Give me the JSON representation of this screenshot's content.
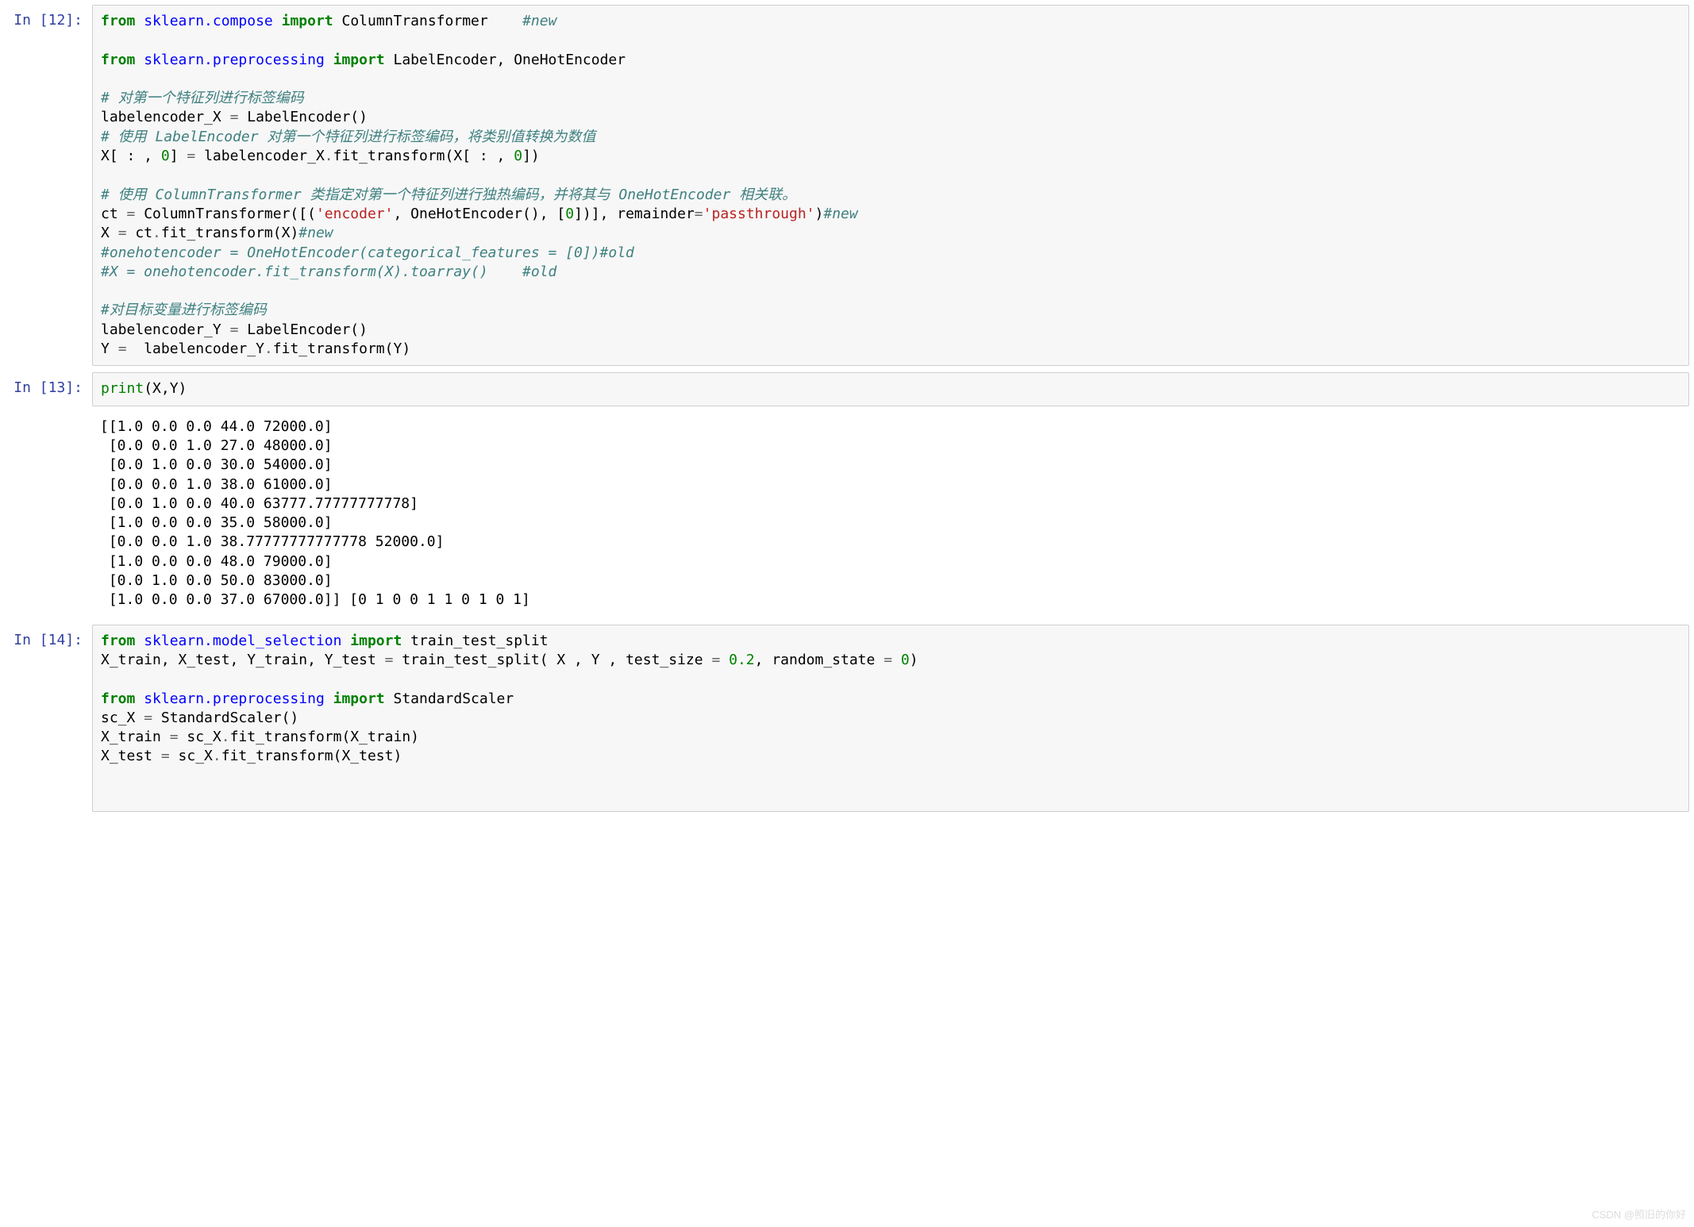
{
  "cells": [
    {
      "prompt": "In [12]:",
      "type": "code",
      "tokens": [
        {
          "t": "from",
          "c": "kn"
        },
        {
          "t": " "
        },
        {
          "t": "sklearn.compose",
          "c": "nn"
        },
        {
          "t": " "
        },
        {
          "t": "import",
          "c": "kn"
        },
        {
          "t": " ColumnTransformer    "
        },
        {
          "t": "#new",
          "c": "cm"
        },
        {
          "t": "\n"
        },
        {
          "t": "\n"
        },
        {
          "t": "from",
          "c": "kn"
        },
        {
          "t": " "
        },
        {
          "t": "sklearn.preprocessing",
          "c": "nn"
        },
        {
          "t": " "
        },
        {
          "t": "import",
          "c": "kn"
        },
        {
          "t": " LabelEncoder, OneHotEncoder"
        },
        {
          "t": "\n"
        },
        {
          "t": "\n"
        },
        {
          "t": "# 对第一个特征列进行标签编码",
          "c": "cm"
        },
        {
          "t": "\n"
        },
        {
          "t": "labelencoder_X "
        },
        {
          "t": "=",
          "c": "op"
        },
        {
          "t": " LabelEncoder()"
        },
        {
          "t": "\n"
        },
        {
          "t": "# 使用 LabelEncoder 对第一个特征列进行标签编码，将类别值转换为数值",
          "c": "cm"
        },
        {
          "t": "\n"
        },
        {
          "t": "X[ : , "
        },
        {
          "t": "0",
          "c": "num"
        },
        {
          "t": "] "
        },
        {
          "t": "=",
          "c": "op"
        },
        {
          "t": " labelencoder_X"
        },
        {
          "t": ".",
          "c": "op"
        },
        {
          "t": "fit_transform(X[ : , "
        },
        {
          "t": "0",
          "c": "num"
        },
        {
          "t": "])"
        },
        {
          "t": "\n"
        },
        {
          "t": "\n"
        },
        {
          "t": "# 使用 ColumnTransformer 类指定对第一个特征列进行独热编码，并将其与 OneHotEncoder 相关联。",
          "c": "cm"
        },
        {
          "t": "\n"
        },
        {
          "t": "ct "
        },
        {
          "t": "=",
          "c": "op"
        },
        {
          "t": " ColumnTransformer([("
        },
        {
          "t": "'encoder'",
          "c": "s"
        },
        {
          "t": ", OneHotEncoder(), ["
        },
        {
          "t": "0",
          "c": "num"
        },
        {
          "t": "])], remainder"
        },
        {
          "t": "=",
          "c": "op"
        },
        {
          "t": "'passthrough'",
          "c": "s"
        },
        {
          "t": ")"
        },
        {
          "t": "#new",
          "c": "cm"
        },
        {
          "t": "\n"
        },
        {
          "t": "X "
        },
        {
          "t": "=",
          "c": "op"
        },
        {
          "t": " ct"
        },
        {
          "t": ".",
          "c": "op"
        },
        {
          "t": "fit_transform(X)"
        },
        {
          "t": "#new",
          "c": "cm"
        },
        {
          "t": "\n"
        },
        {
          "t": "#onehotencoder = OneHotEncoder(categorical_features = [0])#old",
          "c": "cm"
        },
        {
          "t": "\n"
        },
        {
          "t": "#X = onehotencoder.fit_transform(X).toarray()    #old",
          "c": "cm"
        },
        {
          "t": "\n"
        },
        {
          "t": "\n"
        },
        {
          "t": "#对目标变量进行标签编码",
          "c": "cm"
        },
        {
          "t": "\n"
        },
        {
          "t": "labelencoder_Y "
        },
        {
          "t": "=",
          "c": "op"
        },
        {
          "t": " LabelEncoder()"
        },
        {
          "t": "\n"
        },
        {
          "t": "Y "
        },
        {
          "t": "=",
          "c": "op"
        },
        {
          "t": "  labelencoder_Y"
        },
        {
          "t": ".",
          "c": "op"
        },
        {
          "t": "fit_transform(Y)"
        }
      ]
    },
    {
      "prompt": "In [13]:",
      "type": "code",
      "tokens": [
        {
          "t": "print",
          "c": "bi"
        },
        {
          "t": "(X,Y)"
        }
      ]
    },
    {
      "prompt": "",
      "type": "output",
      "text": "[[1.0 0.0 0.0 44.0 72000.0]\n [0.0 0.0 1.0 27.0 48000.0]\n [0.0 1.0 0.0 30.0 54000.0]\n [0.0 0.0 1.0 38.0 61000.0]\n [0.0 1.0 0.0 40.0 63777.77777777778]\n [1.0 0.0 0.0 35.0 58000.0]\n [0.0 0.0 1.0 38.77777777777778 52000.0]\n [1.0 0.0 0.0 48.0 79000.0]\n [0.0 1.0 0.0 50.0 83000.0]\n [1.0 0.0 0.0 37.0 67000.0]] [0 1 0 0 1 1 0 1 0 1]"
    },
    {
      "prompt": "In [14]:",
      "type": "code",
      "tokens": [
        {
          "t": "from",
          "c": "kn"
        },
        {
          "t": " "
        },
        {
          "t": "sklearn.model_selection",
          "c": "nn"
        },
        {
          "t": " "
        },
        {
          "t": "import",
          "c": "kn"
        },
        {
          "t": " train_test_split"
        },
        {
          "t": "\n"
        },
        {
          "t": "X_train, X_test, Y_train, Y_test "
        },
        {
          "t": "=",
          "c": "op"
        },
        {
          "t": " train_test_split( X , Y , test_size "
        },
        {
          "t": "=",
          "c": "op"
        },
        {
          "t": " "
        },
        {
          "t": "0.2",
          "c": "num"
        },
        {
          "t": ", random_state "
        },
        {
          "t": "=",
          "c": "op"
        },
        {
          "t": " "
        },
        {
          "t": "0",
          "c": "num"
        },
        {
          "t": ")"
        },
        {
          "t": "\n"
        },
        {
          "t": "\n"
        },
        {
          "t": "from",
          "c": "kn"
        },
        {
          "t": " "
        },
        {
          "t": "sklearn.preprocessing",
          "c": "nn"
        },
        {
          "t": " "
        },
        {
          "t": "import",
          "c": "kn"
        },
        {
          "t": " StandardScaler"
        },
        {
          "t": "\n"
        },
        {
          "t": "sc_X "
        },
        {
          "t": "=",
          "c": "op"
        },
        {
          "t": " StandardScaler()"
        },
        {
          "t": "\n"
        },
        {
          "t": "X_train "
        },
        {
          "t": "=",
          "c": "op"
        },
        {
          "t": " sc_X"
        },
        {
          "t": ".",
          "c": "op"
        },
        {
          "t": "fit_transform(X_train)"
        },
        {
          "t": "\n"
        },
        {
          "t": "X_test "
        },
        {
          "t": "=",
          "c": "op"
        },
        {
          "t": " sc_X"
        },
        {
          "t": ".",
          "c": "op"
        },
        {
          "t": "fit_transform(X_test)"
        },
        {
          "t": "\n"
        },
        {
          "t": "\n"
        },
        {
          "t": "\n"
        }
      ]
    }
  ],
  "watermark": "CSDN @照旧的你好"
}
